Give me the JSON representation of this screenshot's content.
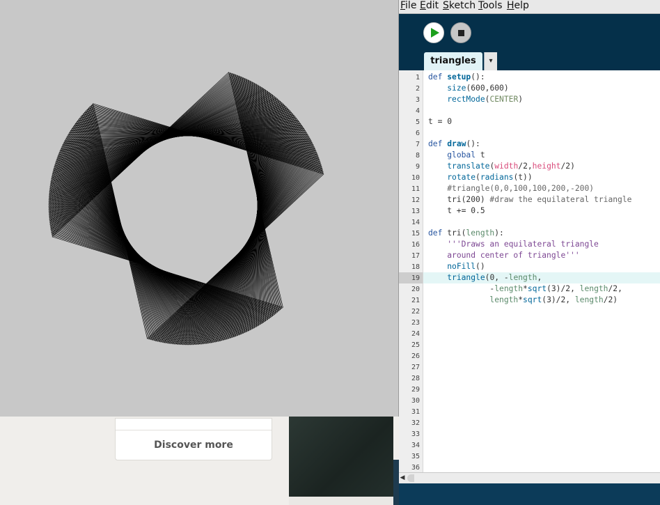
{
  "background_page": {
    "discover_more": "Discover more"
  },
  "ide": {
    "menu": [
      "File",
      "Edit",
      "Sketch",
      "Tools",
      "Help"
    ],
    "menu_mnemonics": [
      "F",
      "E",
      "S",
      "T",
      "H"
    ],
    "toolbar": {
      "run_icon": "play-icon",
      "stop_icon": "stop-icon"
    },
    "tab": {
      "label": "triangles",
      "dropdown_icon": "▾"
    },
    "current_line": 19,
    "line_count": 36,
    "code": [
      "def setup():",
      "    size(600,600)",
      "    rectMode(CENTER)",
      "",
      "t = 0",
      "",
      "def draw():",
      "    global t",
      "    translate(width/2,height/2)",
      "    rotate(radians(t))",
      "    #triangle(0,0,100,100,200,-200)",
      "    tri(200) #draw the equilateral triangle",
      "    t += 0.5",
      "",
      "def tri(length):",
      "    '''Draws an equilateral triangle",
      "    around center of triangle'''",
      "    noFill()",
      "    triangle(0, -length,",
      "             -length*sqrt(3)/2, length/2,",
      "             length*sqrt(3)/2, length/2)"
    ],
    "colors": {
      "toolbar_bg": "#05304a",
      "tab_bg": "#e1f3f7",
      "current_line_bg": "#e4f6f6",
      "run_icon": "#1ca01c"
    }
  },
  "sketch": {
    "background": "#c8c8c8",
    "stroke": "#000000",
    "triangle_size": 200,
    "rotation_step_deg": 0.5
  }
}
